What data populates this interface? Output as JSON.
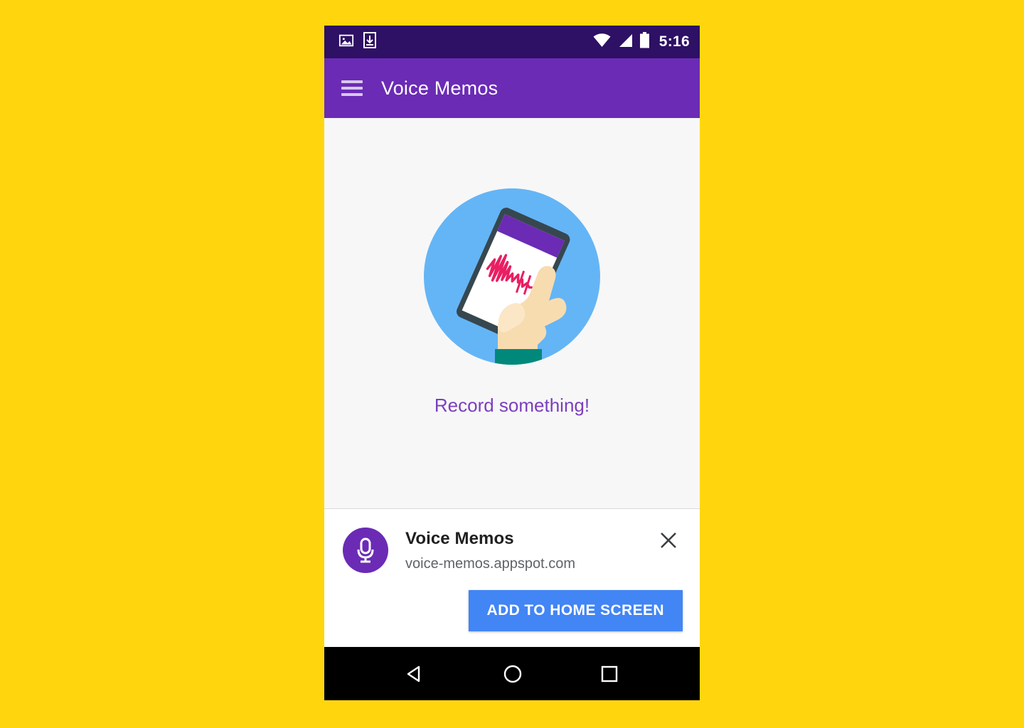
{
  "page": {
    "background_color": "#FFD60E"
  },
  "status_bar": {
    "background_color": "#2E1065",
    "time": "5:16",
    "icons": [
      "image-icon",
      "download-icon",
      "wifi-icon",
      "cell-signal-icon",
      "battery-icon"
    ]
  },
  "app_bar": {
    "background_color": "#6B2BB5",
    "title": "Voice Memos",
    "menu_icon": "hamburger-menu-icon"
  },
  "content": {
    "background_color": "#F7F7F7",
    "illustration": {
      "name": "hand-holding-phone-illustration",
      "circle_color": "#64B5F6",
      "phone_body_color": "#37474F",
      "phone_screen_color": "#FFFFFF",
      "phone_appbar_color": "#6B2BB5",
      "waveform_color": "#E91E63",
      "skin_color": "#F7DCB0",
      "sleeve_color": "#00897B"
    },
    "empty_state_label": "Record something!",
    "empty_state_color": "#7B3FBE"
  },
  "install_banner": {
    "background_color": "#FFFFFF",
    "app_icon": "microphone-icon",
    "app_icon_background": "#6B2BB5",
    "title": "Voice Memos",
    "url": "voice-memos.appspot.com",
    "close_icon": "close-icon",
    "install_button_label": "ADD TO HOME SCREEN",
    "install_button_color": "#4285F4"
  },
  "nav_bar": {
    "background_color": "#000000",
    "buttons": [
      {
        "name": "back-button",
        "icon": "triangle-back-icon"
      },
      {
        "name": "home-button",
        "icon": "circle-home-icon"
      },
      {
        "name": "recents-button",
        "icon": "square-recents-icon"
      }
    ]
  }
}
